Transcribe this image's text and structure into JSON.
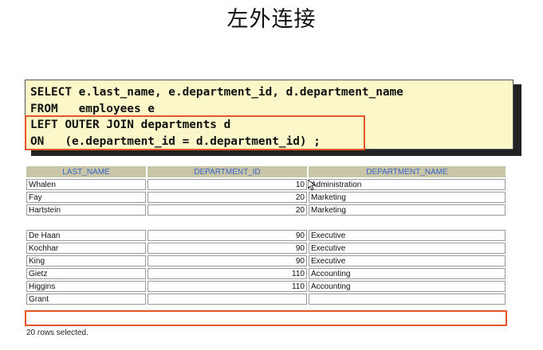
{
  "slide": {
    "title": "左外连接"
  },
  "sql": {
    "lines": [
      "SELECT e.last_name, e.department_id, d.department_name",
      "FROM   employees e",
      "LEFT OUTER JOIN departments d",
      "ON   (e.department_id = d.department_id) ;"
    ]
  },
  "result": {
    "headers": [
      "LAST_NAME",
      "DEPARTMENT_ID",
      "DEPARTMENT_NAME"
    ],
    "rows_top": [
      [
        "Whalen",
        "10",
        "Administration"
      ],
      [
        "Fay",
        "20",
        "Marketing"
      ],
      [
        "Hartstein",
        "20",
        "Marketing"
      ]
    ],
    "rows_bottom": [
      [
        "De Haan",
        "90",
        "Executive"
      ],
      [
        "Kochhar",
        "90",
        "Executive"
      ],
      [
        "King",
        "90",
        "Executive"
      ],
      [
        "Gietz",
        "110",
        "Accounting"
      ],
      [
        "Higgins",
        "110",
        "Accounting"
      ],
      [
        "Grant",
        "",
        ""
      ]
    ],
    "footer": "20 rows selected."
  },
  "colors": {
    "highlight": "#e8542a",
    "header_bg": "#c9c6a8",
    "header_text": "#3a64c8",
    "code_bg": "#fbf7c8"
  }
}
